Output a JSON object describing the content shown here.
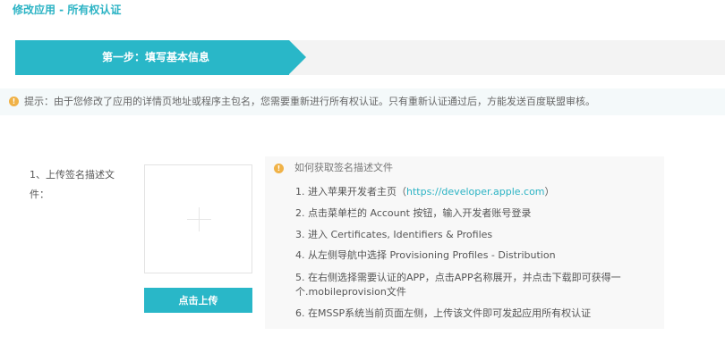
{
  "page": {
    "title": "修改应用 - 所有权认证"
  },
  "step": {
    "label": "第一步：填写基本信息"
  },
  "notice": {
    "icon": "info-icon",
    "text": "提示：由于您修改了应用的详情页地址或程序主包名，您需要重新进行所有权认证。只有重新认证通过后，方能发送百度联盟审核。"
  },
  "form": {
    "label": "1、上传签名描述文件：",
    "upload_button": "点击上传"
  },
  "help": {
    "icon": "info-icon",
    "title": "如何获取签名描述文件",
    "item1_prefix": "1. 进入苹果开发者主页（",
    "item1_link": "https://developer.apple.com",
    "item1_suffix": "）",
    "item2": "2. 点击菜单栏的 Account 按钮，输入开发者账号登录",
    "item3": "3. 进入 Certificates, Identifiers & Profiles",
    "item4": "4. 从左侧导航中选择 Provisioning Profiles - Distribution",
    "item5": "5. 在右侧选择需要认证的APP，点击APP名称展开，并点击下载即可获得一个.mobileprovision文件",
    "item6": "6. 在MSSP系统当前页面左侧，上传该文件即可发起应用所有权认证"
  },
  "colors": {
    "accent": "#29b7c8",
    "warning": "#f0b247"
  }
}
